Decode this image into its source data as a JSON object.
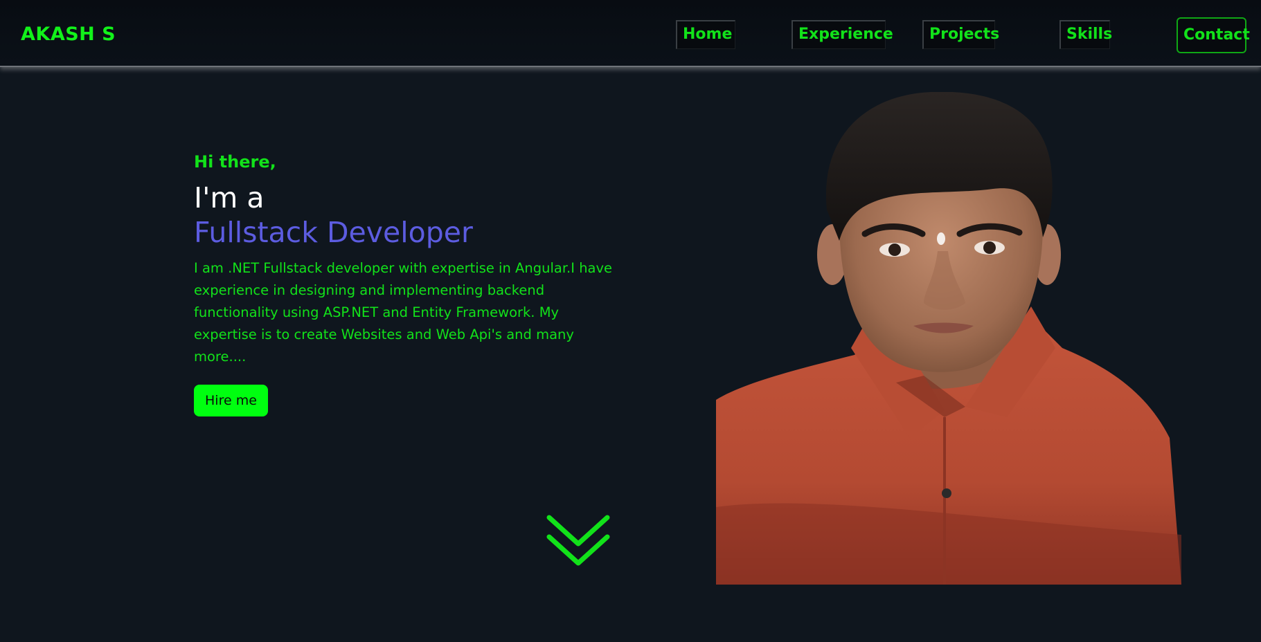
{
  "navbar": {
    "brand": "AKASH S",
    "items": [
      {
        "label": "Home"
      },
      {
        "label": "Experience"
      },
      {
        "label": "Projects"
      },
      {
        "label": "Skills"
      },
      {
        "label": "Contact"
      }
    ]
  },
  "hero": {
    "greeting": "Hi there,",
    "intro": "I'm a",
    "role": "Fullstack Developer",
    "bio": "I am .NET Fullstack developer with expertise in Angular.I have experience in designing and implementing backend functionality using ASP.NET and Entity Framework. My expertise is to create Websites and Web Api's and many more....",
    "cta_label": "Hire me",
    "scroll_icon": "double-chevron-down-icon",
    "portrait": "profile-photo"
  },
  "colors": {
    "accent_green": "#12e21a",
    "button_green": "#00ff10",
    "role_purple": "#5c5ce0",
    "background": "#0f161e"
  }
}
